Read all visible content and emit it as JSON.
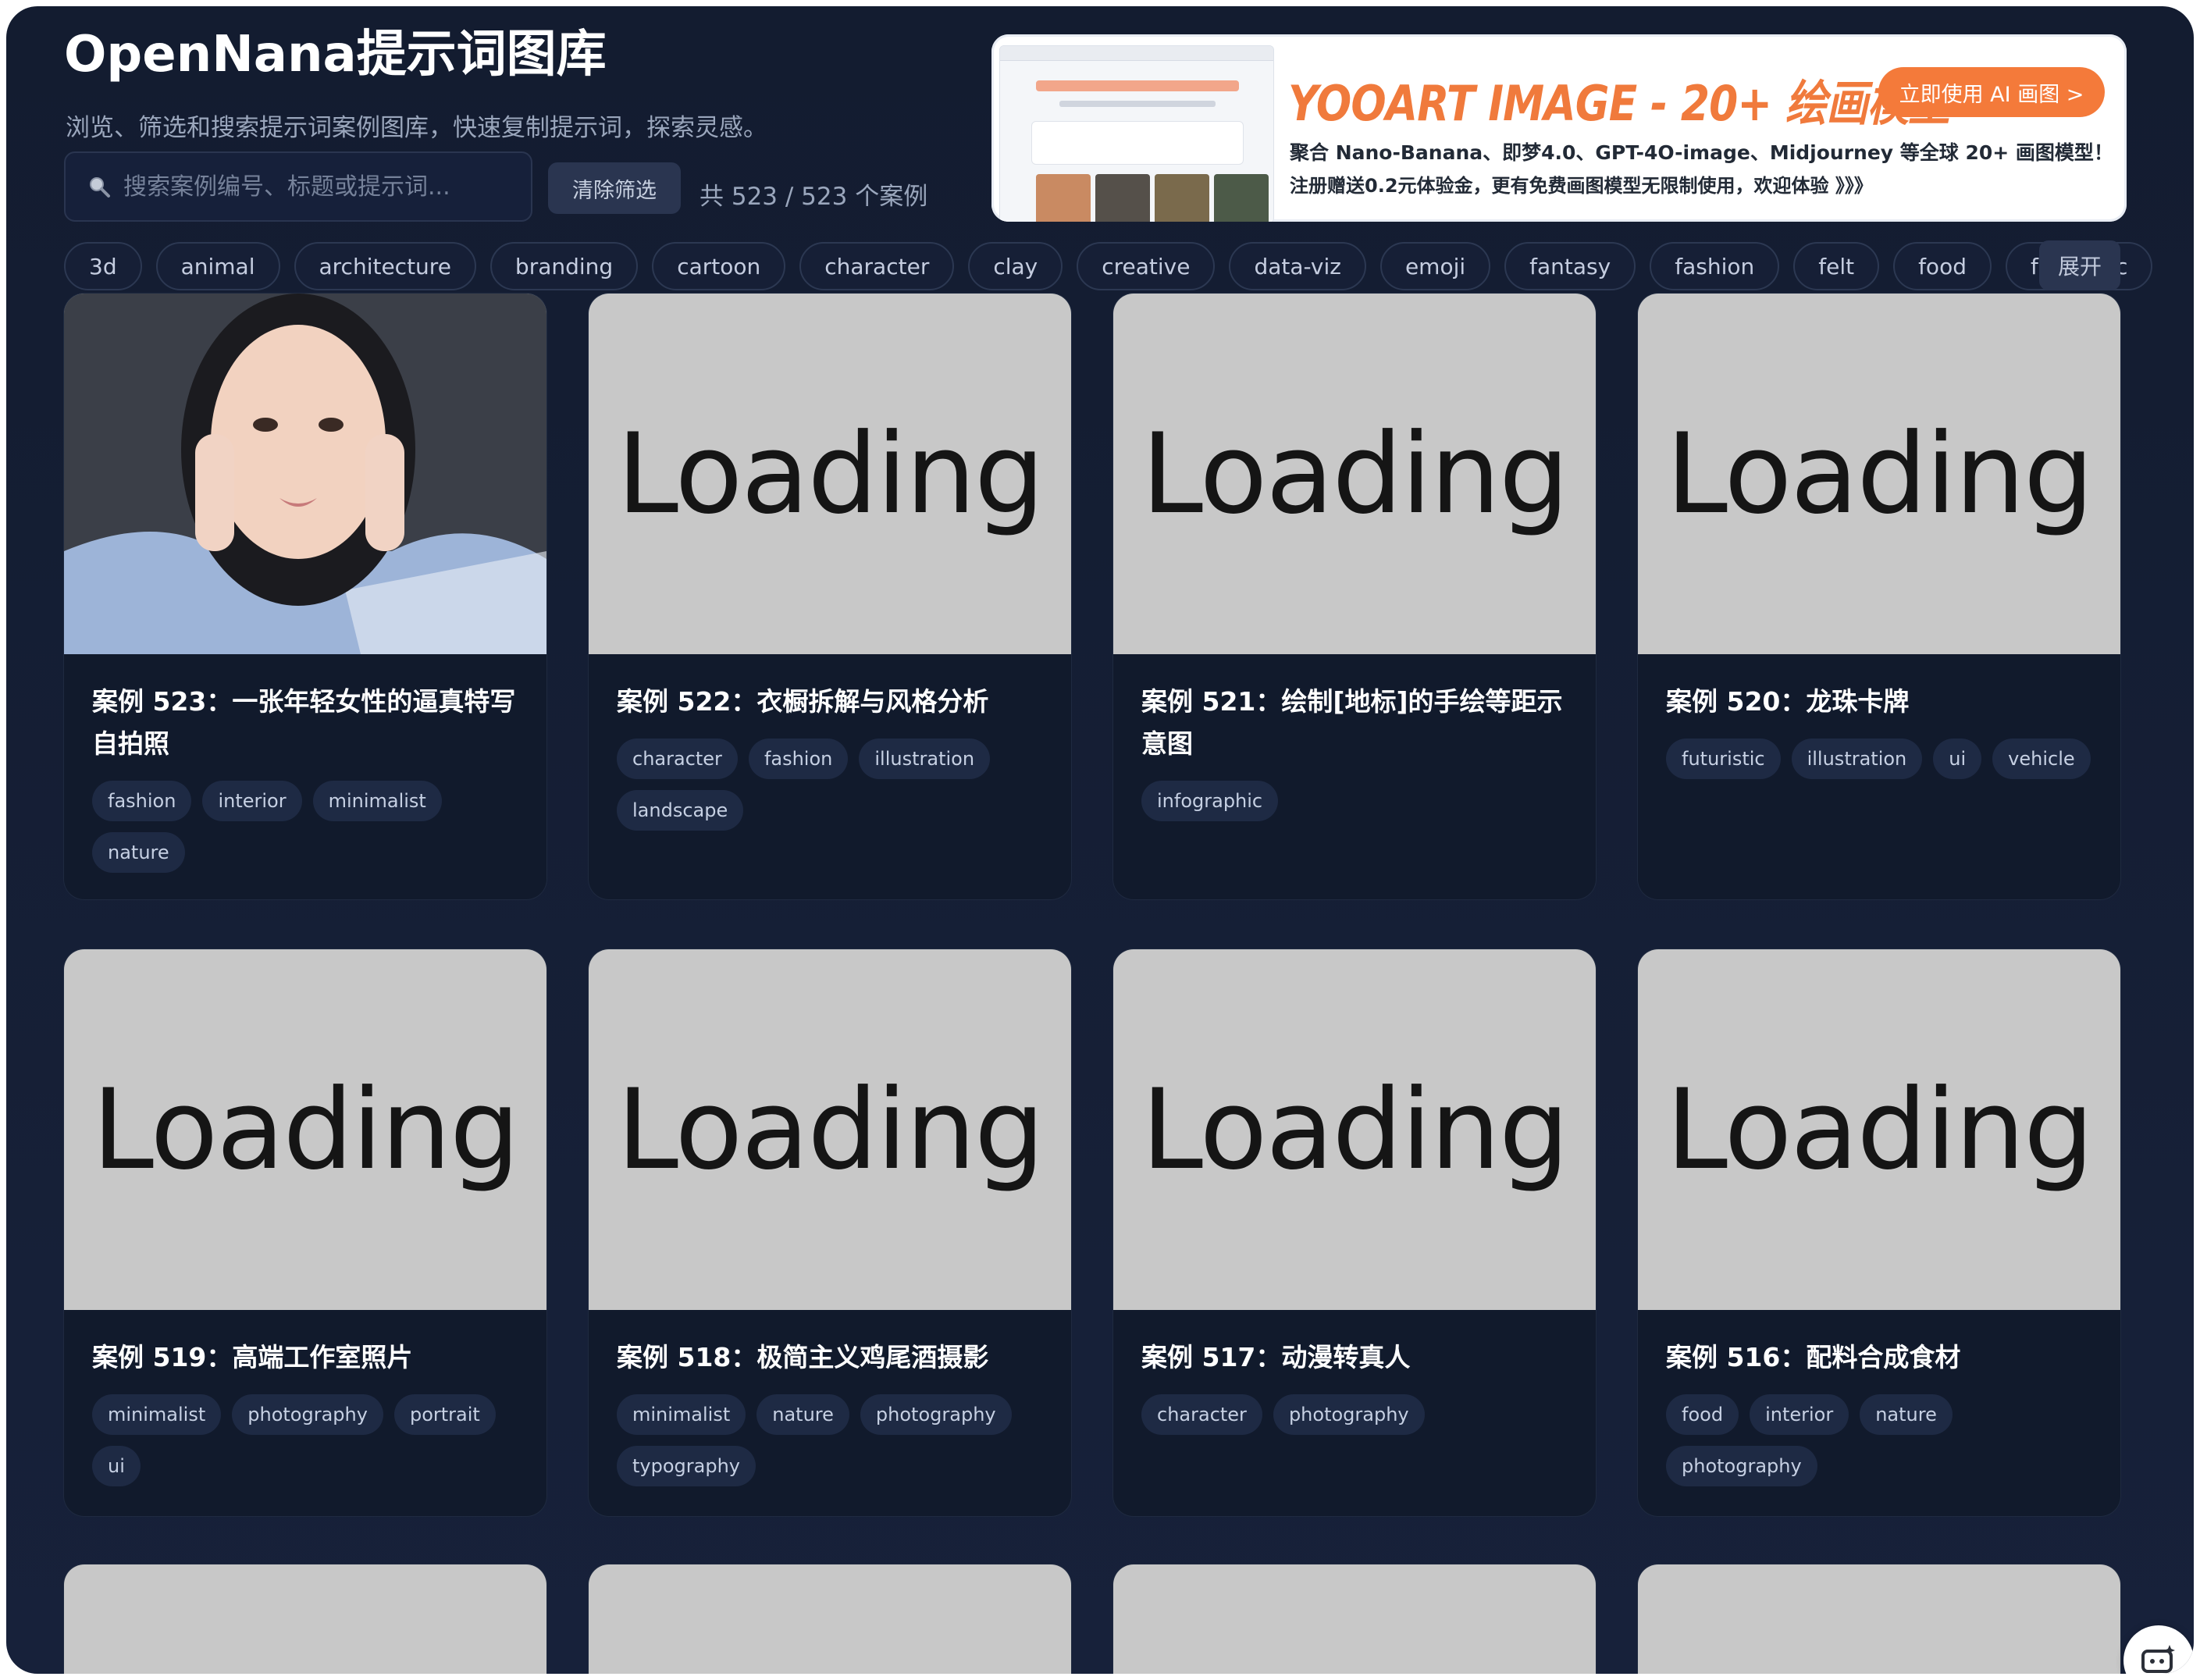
{
  "header": {
    "title": "OpenNana提示词图库",
    "subtitle": "浏览、筛选和搜索提示词案例图库，快速复制提示词，探索灵感。",
    "search_placeholder": "搜索案例编号、标题或提示词...",
    "clear_label": "清除筛选",
    "count_text": "共 523 / 523 个案例"
  },
  "ad": {
    "headline": "YOOART IMAGE - 20+ 绘画模型",
    "cta": "立即使用 AI 画图 >",
    "line1": "聚合 Nano-Banana、即梦4.0、GPT-4O-image、Midjourney 等全球 20+ 画图模型！",
    "line2": "注册赠送0.2元体验金，更有免费画图模型无限制使用，欢迎体验 》》》",
    "accent": "#f07a3c"
  },
  "filters": {
    "tags": [
      "3d",
      "animal",
      "architecture",
      "branding",
      "cartoon",
      "character",
      "clay",
      "creative",
      "data-viz",
      "emoji",
      "fantasy",
      "fashion",
      "felt",
      "food",
      "futuristic"
    ],
    "expand_label": "展开"
  },
  "cards": [
    {
      "title": "案例 523：一张年轻女性的逼真特写自拍照",
      "tags": [
        "fashion",
        "interior",
        "minimalist",
        "nature"
      ],
      "image": "photo"
    },
    {
      "title": "案例 522：衣橱拆解与风格分析",
      "tags": [
        "character",
        "fashion",
        "illustration",
        "landscape"
      ],
      "image": "Loading"
    },
    {
      "title": "案例 521：绘制[地标]的手绘等距示意图",
      "tags": [
        "infographic"
      ],
      "image": "Loading"
    },
    {
      "title": "案例 520：龙珠卡牌",
      "tags": [
        "futuristic",
        "illustration",
        "ui",
        "vehicle"
      ],
      "image": "Loading"
    },
    {
      "title": "案例 519：高端工作室照片",
      "tags": [
        "minimalist",
        "photography",
        "portrait",
        "ui"
      ],
      "image": "Loading"
    },
    {
      "title": "案例 518：极简主义鸡尾酒摄影",
      "tags": [
        "minimalist",
        "nature",
        "photography",
        "typography"
      ],
      "image": "Loading"
    },
    {
      "title": "案例 517：动漫转真人",
      "tags": [
        "character",
        "photography"
      ],
      "image": "Loading"
    },
    {
      "title": "案例 516：配料合成食材",
      "tags": [
        "food",
        "interior",
        "nature",
        "photography"
      ],
      "image": "Loading"
    }
  ],
  "theme": {
    "background": "#131c30",
    "card": "#111a2c",
    "chip": "#1e2a44"
  }
}
